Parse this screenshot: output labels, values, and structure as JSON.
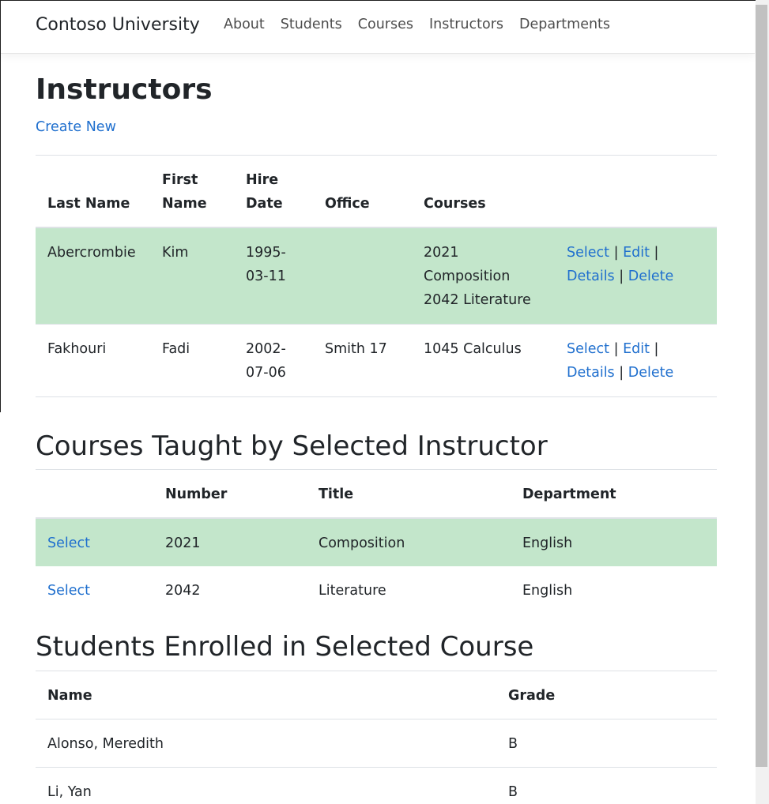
{
  "navbar": {
    "brand": "Contoso University",
    "links": [
      "About",
      "Students",
      "Courses",
      "Instructors",
      "Departments"
    ]
  },
  "page": {
    "title": "Instructors",
    "create_new": "Create New"
  },
  "instructors": {
    "headers": {
      "last_name_1": "Last Name",
      "first_name_1": "First",
      "first_name_2": "Name",
      "hire_date_1": "Hire",
      "hire_date_2": "Date",
      "office": "Office",
      "courses": "Courses"
    },
    "rows": [
      {
        "last_name": "Abercrombie",
        "first_name": "Kim",
        "hire_date_1": "1995-",
        "hire_date_2": "03-11",
        "office": "",
        "course_1": "2021",
        "course_2": "Composition",
        "course_3": "2042 Literature",
        "select": "Select",
        "edit": "Edit",
        "details": "Details",
        "delete": "Delete",
        "sep": "|"
      },
      {
        "last_name": "Fakhouri",
        "first_name": "Fadi",
        "hire_date_1": "2002-",
        "hire_date_2": "07-06",
        "office": "Smith 17",
        "course_1": "1045 Calculus",
        "select": "Select",
        "edit": "Edit",
        "details": "Details",
        "delete": "Delete",
        "sep": "|"
      }
    ]
  },
  "courses_section": {
    "heading": "Courses Taught by Selected Instructor",
    "headers": {
      "number": "Number",
      "title": "Title",
      "department": "Department"
    },
    "rows": [
      {
        "select": "Select",
        "number": "2021",
        "title": "Composition",
        "department": "English"
      },
      {
        "select": "Select",
        "number": "2042",
        "title": "Literature",
        "department": "English"
      }
    ]
  },
  "students_section": {
    "heading": "Students Enrolled in Selected Course",
    "headers": {
      "name": "Name",
      "grade": "Grade"
    },
    "rows": [
      {
        "name": "Alonso, Meredith",
        "grade": "B"
      },
      {
        "name": "Li, Yan",
        "grade": "B"
      }
    ]
  },
  "colors": {
    "selected_row": "#c3e6cb",
    "link": "#1f6fce"
  }
}
